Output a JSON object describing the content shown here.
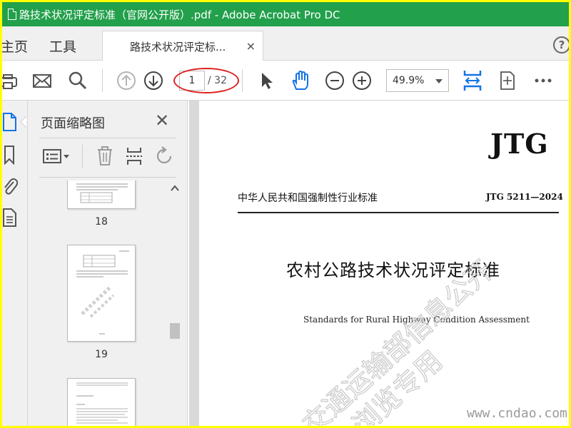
{
  "window": {
    "title": "路技术状况评定标准（官网公开版）.pdf - Adobe Acrobat Pro DC",
    "accent_color": "#22a04b",
    "frame_color": "#ffff00"
  },
  "menu": {
    "home": "主页",
    "tools": "工具"
  },
  "tab": {
    "label": "路技术状况评定标...",
    "close": "×"
  },
  "help": {
    "label": "?"
  },
  "toolbar": {
    "icons": [
      "print-icon",
      "email-icon",
      "search-icon",
      "prev-page-icon",
      "next-page-icon",
      "select-cursor-icon",
      "hand-tool-icon",
      "zoom-out-icon",
      "zoom-in-icon",
      "fit-width-icon",
      "page-view-icon",
      "more-icon"
    ],
    "page_current": "1",
    "page_total": "/ 32",
    "zoom": "49.9%",
    "annotation_color": "#e02020"
  },
  "rail": {
    "icons": [
      "page-thumbnails-icon",
      "bookmark-icon",
      "attachment-icon",
      "document-icon"
    ]
  },
  "thumbnails_panel": {
    "title": "页面缩略图",
    "close": "✕",
    "tools": [
      "options-icon",
      "delete-icon",
      "insert-page-icon",
      "rotate-icon"
    ],
    "pages": [
      {
        "label": "18"
      },
      {
        "label": "19"
      }
    ]
  },
  "document": {
    "logo": "JTG",
    "header": "中华人民共和国强制性行业标准",
    "std_number": "JTG 5211—2024",
    "title": "农村公路技术状况评定标准",
    "subtitle": "Standards for Rural Highway Condition Assessment",
    "watermark": "交通运输部信息公开",
    "watermark_line2": "浏览专用"
  },
  "site_watermark": "www.cndao.com"
}
